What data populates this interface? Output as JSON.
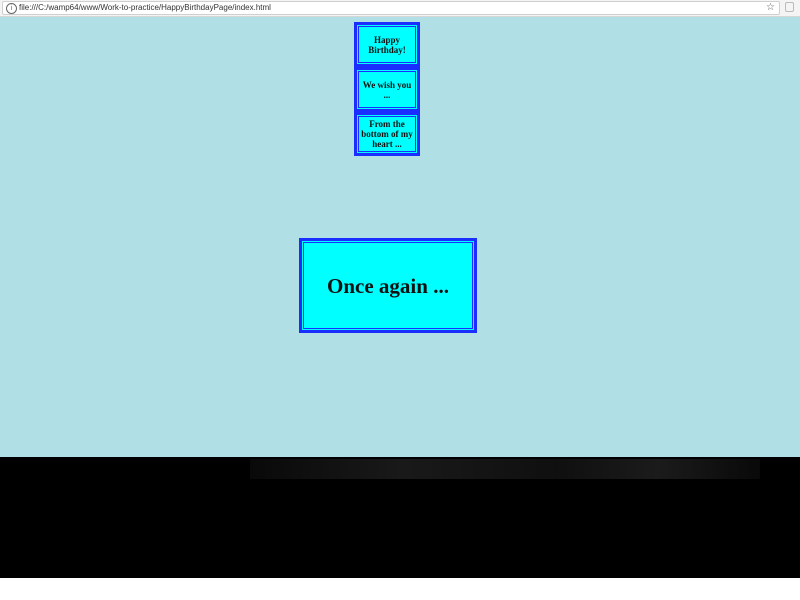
{
  "browser": {
    "url": "file:///C:/wamp64/www/Work-to-practice/HappyBirthdayPage/index.html",
    "info_icon": "info-icon",
    "star_icon": "bookmark-star-icon",
    "extension_icon": "extension-icon"
  },
  "page": {
    "background": "#b0dfe5",
    "card_background": "#00ffff",
    "card_border": "#1a2fff",
    "cards": [
      {
        "text": "Happy Birthday!"
      },
      {
        "text": "We wish you ..."
      },
      {
        "text": "From the bottom of my heart ..."
      }
    ],
    "main_message": "Once again ..."
  }
}
